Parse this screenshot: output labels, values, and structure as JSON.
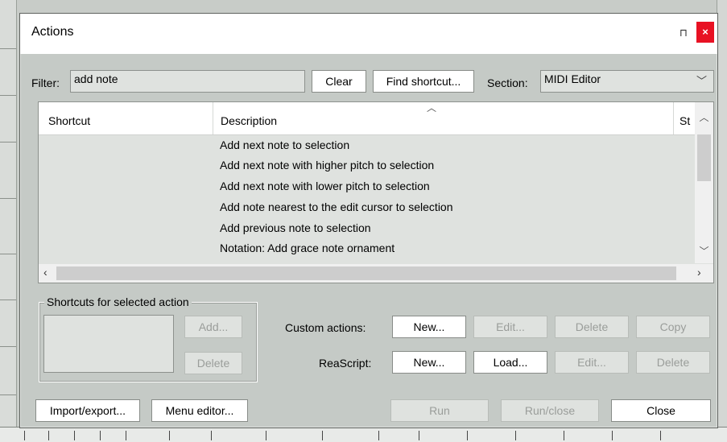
{
  "window": {
    "title": "Actions"
  },
  "filter": {
    "label": "Filter:",
    "value": "add note",
    "clear_label": "Clear",
    "find_shortcut_label": "Find shortcut..."
  },
  "section": {
    "label": "Section:",
    "value": "MIDI Editor"
  },
  "list": {
    "columns": [
      "Shortcut",
      "Description",
      "St"
    ],
    "rows": [
      "Add next note to selection",
      "Add next note with higher pitch to selection",
      "Add next note with lower pitch to selection",
      "Add note nearest to the edit cursor to selection",
      "Add previous note to selection",
      "Notation: Add grace note ornament"
    ]
  },
  "shortcuts_group": {
    "title": "Shortcuts for selected action",
    "add_label": "Add...",
    "delete_label": "Delete"
  },
  "custom_actions": {
    "label": "Custom actions:",
    "new_label": "New...",
    "edit_label": "Edit...",
    "delete_label": "Delete",
    "copy_label": "Copy"
  },
  "reascript": {
    "label": "ReaScript:",
    "new_label": "New...",
    "load_label": "Load...",
    "edit_label": "Edit...",
    "delete_label": "Delete"
  },
  "footer": {
    "import_export_label": "Import/export...",
    "menu_editor_label": "Menu editor...",
    "run_label": "Run",
    "run_close_label": "Run/close",
    "close_label": "Close"
  },
  "icons": {
    "pin": "pin-icon",
    "close": "close-icon",
    "dropdown": "chevron-down-icon",
    "sort": "sort-caret-icon"
  },
  "colors": {
    "close_button": "#e81123",
    "dialog_bg": "#c5cac6",
    "list_bg": "#dfe2df"
  }
}
